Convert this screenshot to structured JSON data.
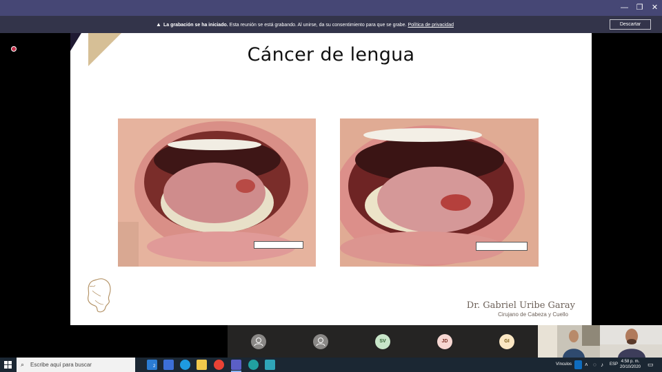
{
  "window": {
    "minimize_glyph": "—",
    "restore_glyph": "❐",
    "close_glyph": "✕"
  },
  "banner": {
    "warning_glyph": "▲",
    "bold_text": "La grabación se ha iniciado.",
    "text": " Esta reunión se está grabando. Al unirse, da su consentimiento para que se grabe. ",
    "link_text": "Política de privacidad",
    "dismiss_label": "Descartar"
  },
  "slide": {
    "title": "Cáncer de lengua",
    "doctor_name": "Dr. Gabriel Uribe Garay",
    "doctor_subtitle": "Cirujano de Cabeza y Cuello"
  },
  "participants": [
    {
      "initials": "",
      "kind": "generic"
    },
    {
      "initials": "",
      "kind": "generic"
    },
    {
      "initials": "SV",
      "kind": "sv"
    },
    {
      "initials": "JD",
      "kind": "jd"
    },
    {
      "initials": "GI",
      "kind": "gi"
    }
  ],
  "taskbar": {
    "search_placeholder": "Escribe aquí para buscar",
    "mail_badge": "2",
    "links_label": "Vínculos",
    "language": "ESP",
    "time": "4:58 p. m.",
    "date": "20/10/2020"
  },
  "colors": {
    "titlebar": "#464775",
    "banner": "#33344a",
    "taskbar": "#1b2733",
    "slide_gold": "#d6bf96"
  }
}
